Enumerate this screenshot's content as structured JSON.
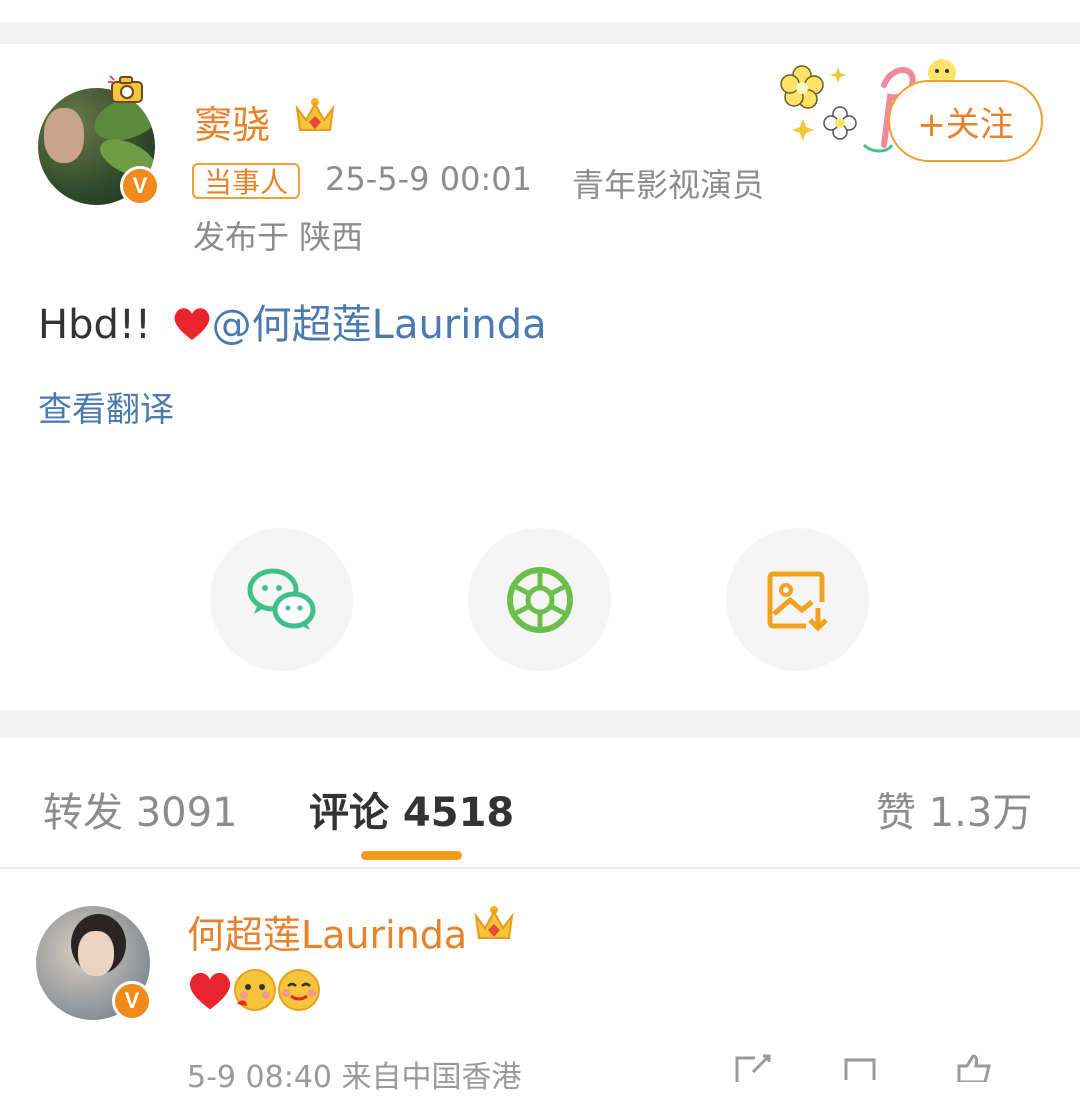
{
  "post": {
    "author": "窦骁",
    "tag": "当事人",
    "time": "25-5-9 00:01",
    "title": "青年影视演员",
    "location": "发布于 陕西",
    "follow_label": "+关注",
    "text_prefix": "Hbd!!",
    "mention": "@何超莲Laurinda",
    "translate_label": "查看翻译"
  },
  "share": {
    "items": [
      "wechat-icon",
      "moments-icon",
      "save-image-icon"
    ],
    "colors": {
      "wechat": "#3fbf8a",
      "moments": "#6cc04a",
      "save": "#f2a21c"
    }
  },
  "tabs": {
    "repost": "转发 3091",
    "comment": "评论 4518",
    "like": "赞 1.3万"
  },
  "comment": {
    "author": "何超莲Laurinda",
    "meta": "5-9 08:40 来自中国香港"
  },
  "colors": {
    "accent": "#e8822a",
    "link": "#4b7ab0",
    "tab_indicator": "#f39b1c"
  }
}
